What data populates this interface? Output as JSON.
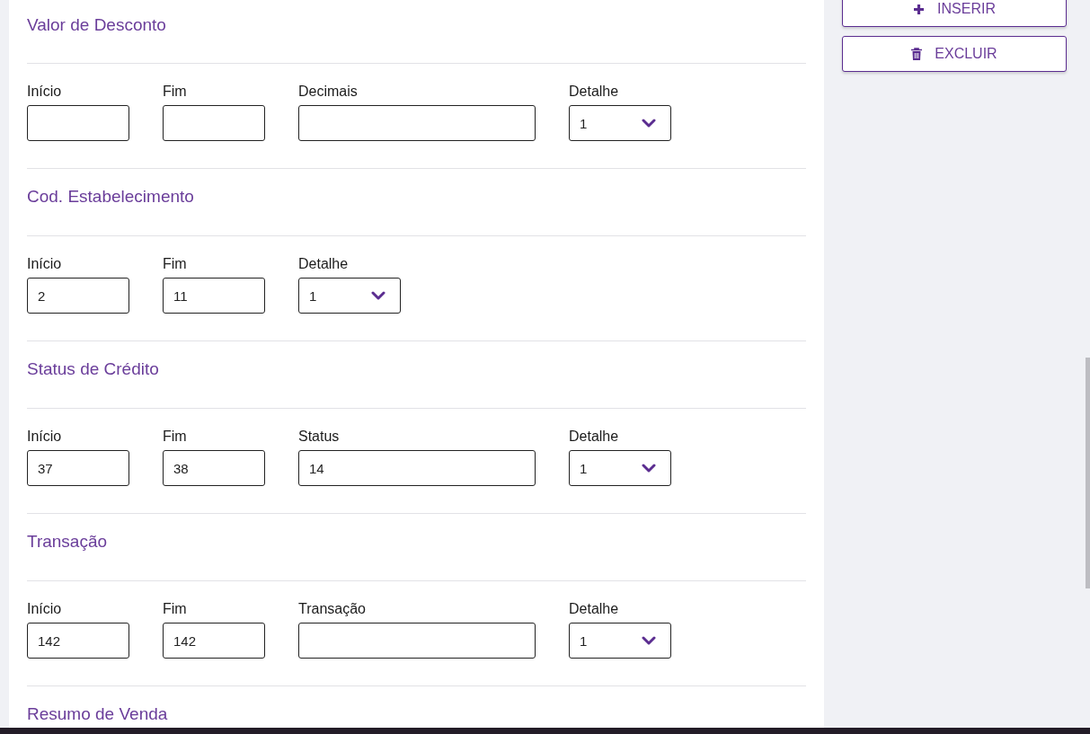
{
  "sections": [
    {
      "title": "Valor de Desconto",
      "fields": [
        {
          "label": "Início",
          "kind": "text"
        },
        {
          "label": "Fim",
          "kind": "text"
        },
        {
          "label": "Decimais",
          "kind": "wide"
        },
        {
          "label": "Detalhe",
          "kind": "select",
          "value": "1"
        }
      ]
    },
    {
      "title": "Cod. Estabelecimento",
      "fields": [
        {
          "label": "Início",
          "kind": "text",
          "value": "2"
        },
        {
          "label": "Fim",
          "kind": "text",
          "value": "11"
        },
        {
          "label": "Detalhe",
          "kind": "select",
          "value": "1"
        }
      ]
    },
    {
      "title": "Status de Crédito",
      "fields": [
        {
          "label": "Início",
          "kind": "text",
          "value": "37"
        },
        {
          "label": "Fim",
          "kind": "text",
          "value": "38"
        },
        {
          "label": "Status",
          "kind": "wide",
          "value": "14"
        },
        {
          "label": "Detalhe",
          "kind": "select",
          "value": "1"
        }
      ]
    },
    {
      "title": "Transação",
      "fields": [
        {
          "label": "Início",
          "kind": "text",
          "value": "142"
        },
        {
          "label": "Fim",
          "kind": "text",
          "value": "142"
        },
        {
          "label": "Transação",
          "kind": "wide"
        },
        {
          "label": "Detalhe",
          "kind": "select",
          "value": "1"
        }
      ]
    },
    {
      "title": "Resumo de Venda"
    }
  ],
  "actions": [
    {
      "label": "INSERIR",
      "kind": "add"
    },
    {
      "label": "EXCLUIR",
      "kind": "delete"
    }
  ]
}
